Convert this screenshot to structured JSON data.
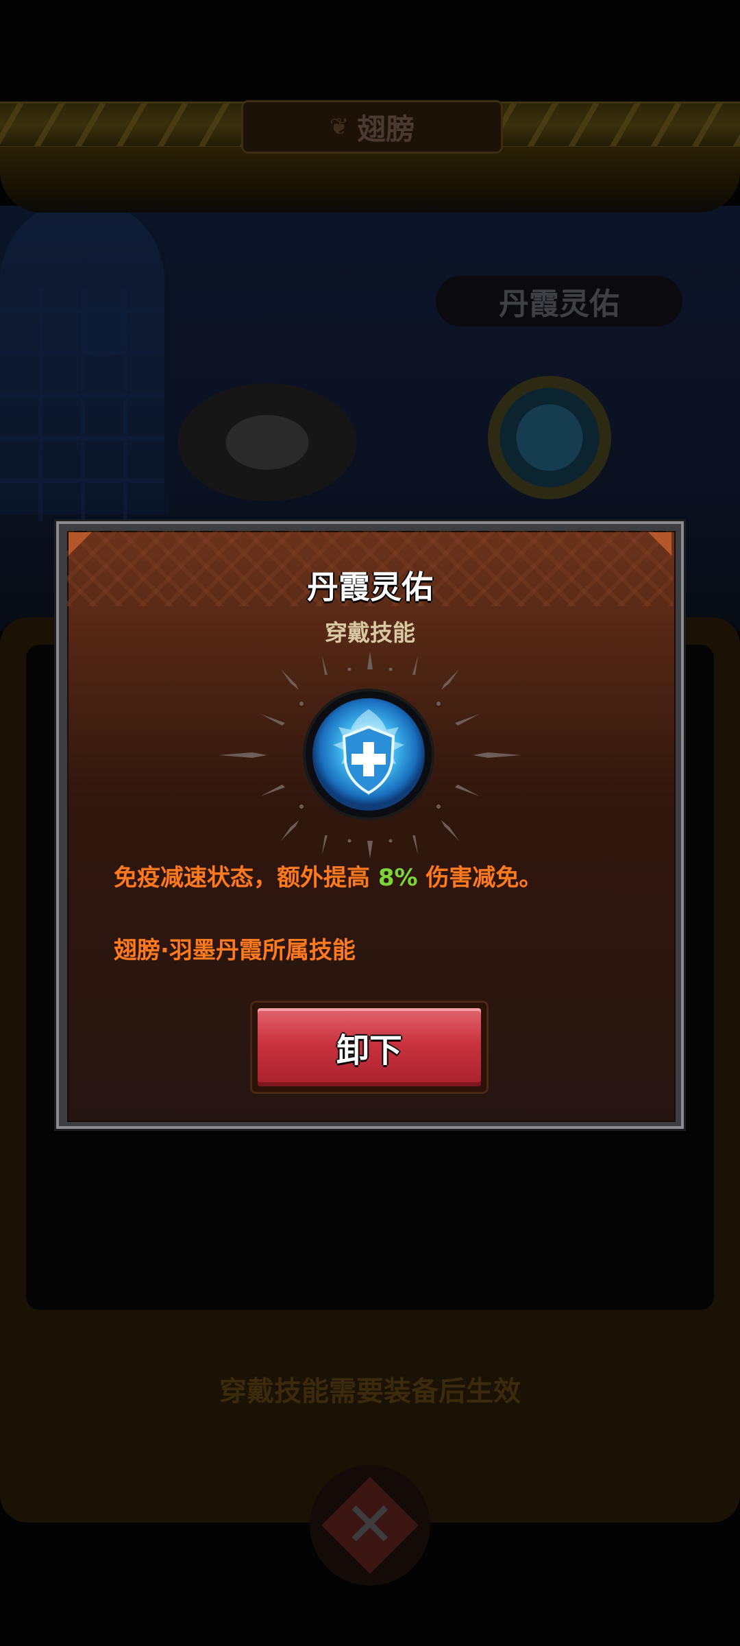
{
  "screen": {
    "header_title": "翅膀",
    "wing_name_plate": "丹霞灵佑",
    "hint": "穿戴技能需要装备后生效"
  },
  "modal": {
    "title": "丹霞灵佑",
    "subtitle": "穿戴技能",
    "skill_icon": "shield-cross-icon",
    "description_before": "免疫减速状态，额外提高 ",
    "description_value": "8%",
    "description_after": " 伤害减免。",
    "source": "翅膀·羽墨丹霞所属技能",
    "unequip_label": "卸下"
  },
  "colors": {
    "accent_orange": "#ff7a1e",
    "accent_green": "#7cd63a",
    "button_red": "#c9323e",
    "modal_brown": "#4a2312"
  }
}
